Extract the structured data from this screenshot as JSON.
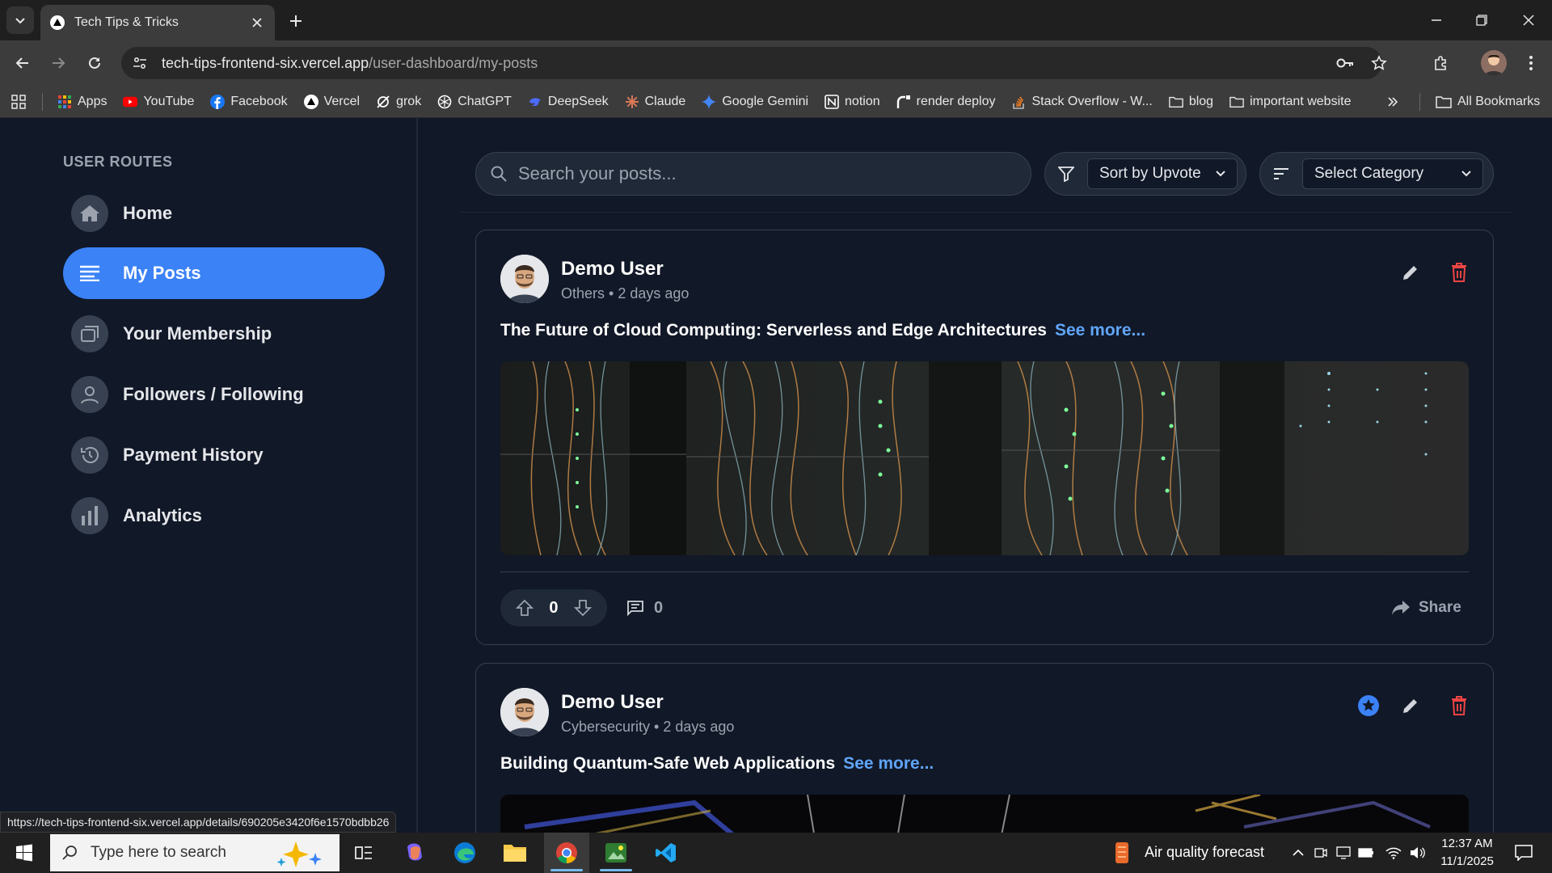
{
  "browser": {
    "tab_title": "Tech Tips & Tricks",
    "url_host": "tech-tips-frontend-six.vercel.app",
    "url_path": "/user-dashboard/my-posts",
    "bookmarks": [
      {
        "label": "Apps",
        "icon": "apps-grid-icon",
        "color": "#ea4335"
      },
      {
        "label": "YouTube",
        "icon": "youtube-icon",
        "color": "#ff0000"
      },
      {
        "label": "Facebook",
        "icon": "facebook-icon",
        "color": "#1877f2"
      },
      {
        "label": "Vercel",
        "icon": "vercel-icon",
        "color": "#ffffff"
      },
      {
        "label": "grok",
        "icon": "grok-icon",
        "color": "#ffffff"
      },
      {
        "label": "ChatGPT",
        "icon": "chatgpt-icon",
        "color": "#ffffff"
      },
      {
        "label": "DeepSeek",
        "icon": "deepseek-icon",
        "color": "#4d6bfe"
      },
      {
        "label": "Claude",
        "icon": "claude-icon",
        "color": "#d97757"
      },
      {
        "label": "Google Gemini",
        "icon": "gemini-icon",
        "color": "#4285f4"
      },
      {
        "label": "notion",
        "icon": "notion-icon",
        "color": "#ffffff"
      },
      {
        "label": "render deploy",
        "icon": "render-icon",
        "color": "#ffffff"
      },
      {
        "label": "Stack Overflow - W...",
        "icon": "stackoverflow-icon",
        "color": "#f48024"
      },
      {
        "label": "blog",
        "icon": "folder-icon",
        "color": "#e8e8e8"
      },
      {
        "label": "important website",
        "icon": "folder-icon",
        "color": "#e8e8e8"
      }
    ],
    "all_bookmarks": "All Bookmarks",
    "status_url": "https://tech-tips-frontend-six.vercel.app/details/690205e3420f6e1570bdbb26"
  },
  "sidebar": {
    "heading": "USER ROUTES",
    "items": [
      {
        "label": "Home",
        "icon": "home-icon",
        "active": false
      },
      {
        "label": "My Posts",
        "icon": "list-icon",
        "active": true
      },
      {
        "label": "Your Membership",
        "icon": "membership-icon",
        "active": false
      },
      {
        "label": "Followers / Following",
        "icon": "user-icon",
        "active": false
      },
      {
        "label": "Payment History",
        "icon": "history-icon",
        "active": false
      },
      {
        "label": "Analytics",
        "icon": "bar-chart-icon",
        "active": false
      }
    ]
  },
  "filters": {
    "search_placeholder": "Search your posts...",
    "sort_value": "Sort by Upvote",
    "category_value": "Select Category"
  },
  "posts": [
    {
      "author": "Demo User",
      "category": "Others",
      "time": "2 days ago",
      "title": "The Future of Cloud Computing: Serverless and Edge Architectures",
      "see_more": "See more...",
      "votes": "0",
      "comments": "0",
      "share": "Share",
      "premium": false
    },
    {
      "author": "Demo User",
      "category": "Cybersecurity",
      "time": "2 days ago",
      "title": "Building Quantum-Safe Web Applications",
      "see_more": "See more...",
      "premium": true
    }
  ],
  "colors": {
    "accent": "#3b82f6",
    "delete": "#ef4444",
    "link": "#60a5fa"
  },
  "taskbar": {
    "search_placeholder": "Type here to search",
    "weather": "Air quality forecast",
    "time": "12:37 AM",
    "date": "11/1/2025"
  }
}
